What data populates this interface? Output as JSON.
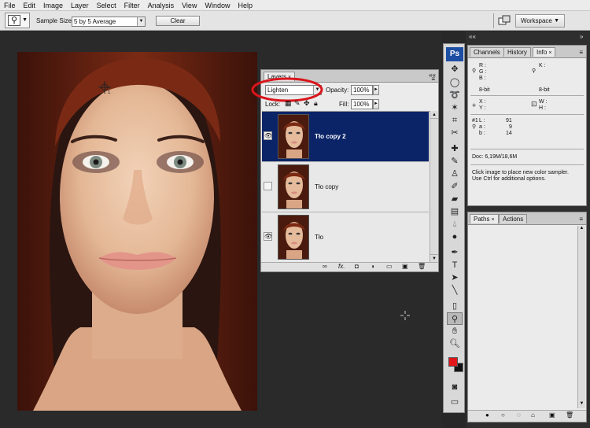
{
  "menubar": [
    "File",
    "Edit",
    "Image",
    "Layer",
    "Select",
    "Filter",
    "Analysis",
    "View",
    "Window",
    "Help"
  ],
  "options": {
    "sample_size_label": "Sample Size:",
    "sample_size_value": "5 by 5 Average",
    "clear_label": "Clear",
    "workspace_label": "Workspace"
  },
  "layers_panel": {
    "tab": "Layers",
    "blend_mode": "Lighten",
    "opacity_label": "Opacity:",
    "opacity_value": "100%",
    "lock_label": "Lock:",
    "fill_label": "Fill:",
    "fill_value": "100%",
    "layers": [
      {
        "name": "Tło copy 2",
        "visible": true,
        "selected": true
      },
      {
        "name": "Tło copy",
        "visible": false,
        "selected": false
      },
      {
        "name": "Tło",
        "visible": true,
        "selected": false
      }
    ],
    "fx_label": "fx."
  },
  "toolbox": {
    "ps_logo": "Ps"
  },
  "info_panel": {
    "tabs": [
      "Channels",
      "History",
      "Info"
    ],
    "rgb_labels": [
      "R :",
      "G :",
      "B :"
    ],
    "k_label": "K :",
    "bit_left": "8-bit",
    "bit_right": "8-bit",
    "x_label": "X :",
    "y_label": "Y :",
    "w_label": "W :",
    "h_label": "H :",
    "sampler_id": "#1",
    "lab": [
      {
        "label": "L :",
        "value": "91"
      },
      {
        "label": "a :",
        "value": "9"
      },
      {
        "label": "b :",
        "value": "14"
      }
    ],
    "doc": "Doc: 6,19M/18,6M",
    "hint_line1": "Click image to place new color sampler.",
    "hint_line2": "Use Ctrl for additional options."
  },
  "paths_panel": {
    "tabs": [
      "Paths",
      "Actions"
    ]
  },
  "colors": {
    "foreground": "#e0161b",
    "background": "#111111",
    "selection": "#0b2468",
    "annotation": "#d9161c"
  }
}
